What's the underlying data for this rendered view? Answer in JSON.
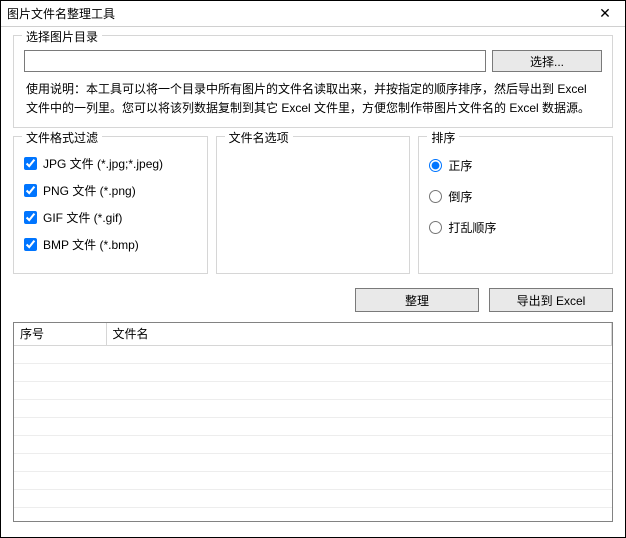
{
  "window": {
    "title": "图片文件名整理工具",
    "close_symbol": "✕"
  },
  "dir_group": {
    "legend": "选择图片目录",
    "input_value": "",
    "browse_label": "选择...",
    "description": "使用说明：本工具可以将一个目录中所有图片的文件名读取出来，并按指定的顺序排序，然后导出到 Excel 文件中的一列里。您可以将该列数据复制到其它 Excel 文件里，方便您制作带图片文件名的 Excel 数据源。"
  },
  "filter_group": {
    "legend": "文件格式过滤",
    "items": [
      {
        "label": "JPG 文件 (*.jpg;*.jpeg)",
        "checked": true
      },
      {
        "label": "PNG 文件 (*.png)",
        "checked": true
      },
      {
        "label": "GIF 文件 (*.gif)",
        "checked": true
      },
      {
        "label": "BMP 文件 (*.bmp)",
        "checked": true
      }
    ]
  },
  "name_options_group": {
    "legend": "文件名选项"
  },
  "sort_group": {
    "legend": "排序",
    "items": [
      {
        "label": "正序",
        "checked": true
      },
      {
        "label": "倒序",
        "checked": false
      },
      {
        "label": "打乱顺序",
        "checked": false
      }
    ]
  },
  "actions": {
    "organize_label": "整理",
    "export_label": "导出到 Excel"
  },
  "table": {
    "col_seq": "序号",
    "col_filename": "文件名"
  }
}
